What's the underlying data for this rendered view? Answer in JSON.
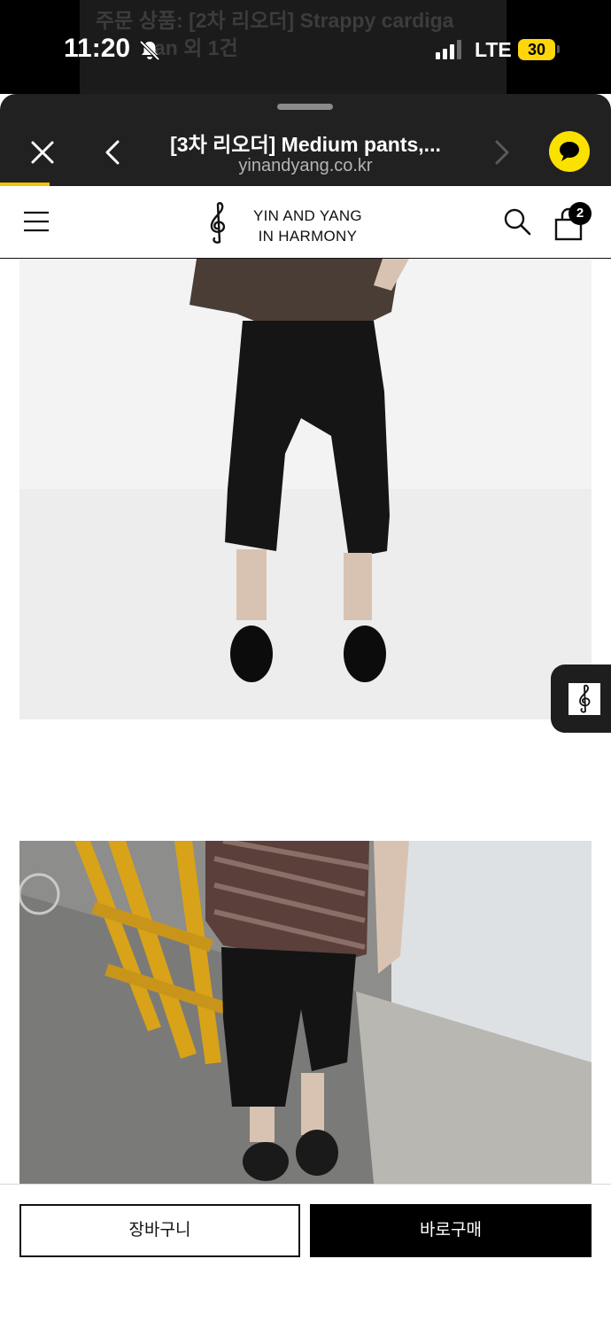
{
  "status_bar": {
    "time": "11:20",
    "network": "LTE",
    "battery": "30",
    "notification_peek": [
      "주문 상품: [2차 리오더] Strappy cardiga",
      "an 외 1건"
    ]
  },
  "browser": {
    "tab_title": "[3차 리오더] Medium pants,...",
    "url": "yinandyang.co.kr"
  },
  "site": {
    "logo_line1": "YIN AND YANG",
    "logo_line2": "IN HARMONY",
    "cart_count": "2"
  },
  "actions": {
    "add_to_cart": "장바구니",
    "buy_now": "바로구매"
  },
  "colors": {
    "accent_yellow": "#fae100",
    "progress": "#f5c400",
    "sheet_bg": "#212121"
  }
}
